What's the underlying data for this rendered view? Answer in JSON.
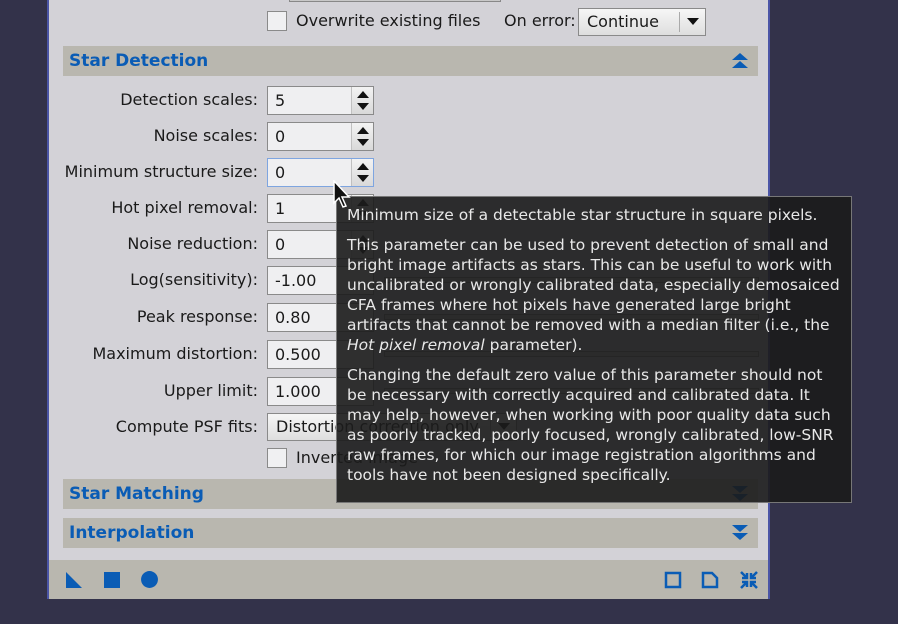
{
  "top": {
    "overwrite_label": "Overwrite existing files",
    "overwrite_checked": false,
    "on_error_label": "On error:",
    "on_error_value": "Continue"
  },
  "star_detection": {
    "title": "Star Detection",
    "expanded": true,
    "params": [
      {
        "label": "Detection scales:",
        "value": "5"
      },
      {
        "label": "Noise scales:",
        "value": "0"
      },
      {
        "label": "Minimum structure size:",
        "value": "0"
      },
      {
        "label": "Hot pixel removal:",
        "value": "1"
      },
      {
        "label": "Noise reduction:",
        "value": "0"
      },
      {
        "label": "Log(sensitivity):",
        "value": "-1.00"
      },
      {
        "label": "Peak response:",
        "value": "0.80"
      },
      {
        "label": "Maximum distortion:",
        "value": "0.500"
      },
      {
        "label": "Upper limit:",
        "value": "1.000"
      }
    ],
    "psf_label": "Compute PSF fits:",
    "psf_value": "Distortion correction only",
    "inverted_label": "Inverted image",
    "inverted_checked": false
  },
  "sections": [
    {
      "title": "Star Matching",
      "expanded": false
    },
    {
      "title": "Interpolation",
      "expanded": false
    }
  ],
  "tooltip": {
    "p1": "Minimum size of a detectable star structure in square pixels.",
    "p2": "This parameter can be used to prevent detection of small and bright image artifacts as stars. This can be useful to work with uncalibrated or wrongly calibrated data, especially demosaiced CFA frames where hot pixels have generated large bright artifacts that cannot be removed with a median filter (i.e., the ",
    "p2_em": "Hot pixel removal",
    "p2_end": " parameter).",
    "p3": "Changing the default zero value of this parameter should not be necessary with correctly acquired and calibrated data. It may help, however, when working with poor quality data such as poorly tracked, poorly focused, wrongly calibrated, low-SNR raw frames, for which our image registration algorithms and tools have not been designed specifically."
  },
  "toolbar": {
    "left": [
      "new-instance-icon",
      "apply-global-icon",
      "apply-icon"
    ],
    "right": [
      "browse-docs-icon",
      "new-document-icon",
      "reset-icon"
    ]
  },
  "colors": {
    "accent": "#0a5cb5",
    "section_bg": "#b9b7af",
    "panel_bg": "#d3d2d7",
    "desktop_bg": "#33324a",
    "window_border": "#4b55a6"
  }
}
